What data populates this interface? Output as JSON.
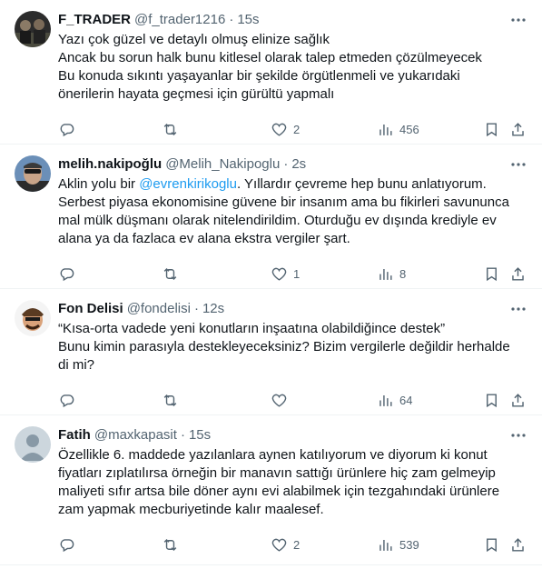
{
  "tweets": [
    {
      "name": "F_TRADER",
      "handle": "@f_trader1216",
      "time": "15s",
      "lines": [
        "Yazı çok güzel ve detaylı olmuş elinize sağlık",
        "Ancak bu sorun halk bunu kitlesel olarak talep etmeden çözülmeyecek",
        "Bu konuda sıkıntı yaşayanlar bir şekilde örgütlenmeli ve yukarıdaki",
        "önerilerin hayata geçmesi için gürültü yapmalı"
      ],
      "likes": "2",
      "views": "456"
    },
    {
      "name": "melih.nakipoğlu",
      "handle": "@Melih_Nakipoglu",
      "time": "2s",
      "line1_pre": "Aklin yolu bir ",
      "line1_mention": "@evrenkirikoglu",
      "line1_post": ". Yıllardır çevreme hep bunu anlatıyorum.",
      "lines": [
        "Serbest piyasa ekonomisine güvene bir insanım ama bu fikirleri savununca",
        "mal mülk düşmanı olarak nitelendirildim. Oturduğu ev dışında krediyle ev",
        "alana ya da fazlaca ev alana ekstra vergiler  şart."
      ],
      "likes": "1",
      "views": "8"
    },
    {
      "name": "Fon Delisi",
      "handle": "@fondelisi",
      "time": "12s",
      "lines": [
        "“Kısa-orta vadede yeni konutların inşaatına olabildiğince destek”",
        "Bunu kimin parasıyla destekleyeceksiniz? Bizim vergilerle değildir herhalde",
        "di mi?"
      ],
      "likes": "",
      "views": "64"
    },
    {
      "name": "Fatih",
      "handle": "@maxkapasit",
      "time": "15s",
      "lines": [
        "Özellikle 6. maddede yazılanlara aynen katılıyorum ve diyorum ki konut",
        "fiyatları zıplatılırsa örneğin bir manavın sattığı ürünlere hiç zam gelmeyip",
        "maliyeti sıfır artsa bile döner aynı evi alabilmek için tezgahındaki ürünlere",
        "zam yapmak mecburiyetinde kalır maalesef."
      ],
      "likes": "2",
      "views": "539"
    }
  ],
  "separator": "·",
  "icons": {
    "more": "more-dots-icon",
    "reply": "reply-icon",
    "retweet": "retweet-icon",
    "like": "heart-icon",
    "views": "views-icon",
    "bookmark": "bookmark-icon",
    "share": "share-icon"
  },
  "colors": {
    "text": "#0f1419",
    "secondary": "#536471",
    "link": "#1d9bf0",
    "border": "#eff3f4"
  }
}
